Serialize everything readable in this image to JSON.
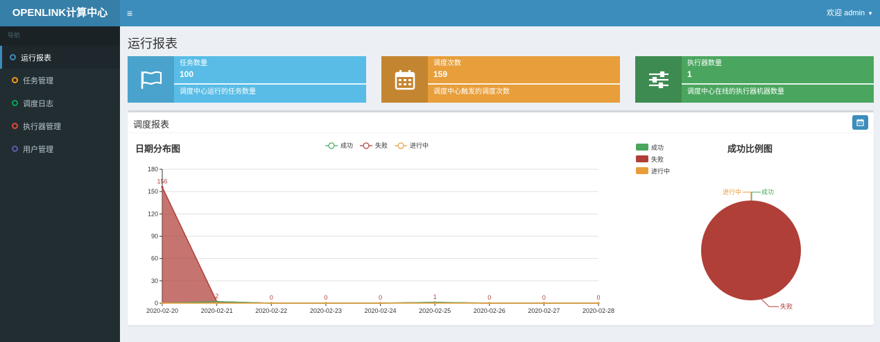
{
  "app": {
    "logo": "OPENLINK计算中心",
    "menu_toggle": "≡",
    "user_label": "欢迎 admin",
    "user_caret": "▼"
  },
  "sidebar": {
    "header": "导航",
    "items": [
      {
        "label": "运行报表",
        "color": "#3c8dbc"
      },
      {
        "label": "任务管理",
        "color": "#f39c12"
      },
      {
        "label": "调度日志",
        "color": "#00a65a"
      },
      {
        "label": "执行器管理",
        "color": "#dd4b39"
      },
      {
        "label": "用户管理",
        "color": "#605ca8"
      }
    ]
  },
  "page": {
    "title": "运行报表"
  },
  "info_boxes": [
    {
      "label": "任务数量",
      "value": "100",
      "desc": "调度中心运行的任务数量",
      "color": "#58bce6",
      "icon_bg": "#4aa3cc",
      "icon": "flag-icon"
    },
    {
      "label": "调度次数",
      "value": "159",
      "desc": "调度中心触发的调度次数",
      "color": "#e89e3a",
      "icon_bg": "#c48530",
      "icon": "calendar-icon"
    },
    {
      "label": "执行器数量",
      "value": "1",
      "desc": "调度中心在线的执行器机器数量",
      "color": "#4aa65f",
      "icon_bg": "#3d8b50",
      "icon": "sliders-icon"
    }
  ],
  "report": {
    "title": "调度报表",
    "date_button_icon": "calendar-icon"
  },
  "chart_data": [
    {
      "type": "area",
      "title": "日期分布图",
      "categories": [
        "2020-02-20",
        "2020-02-21",
        "2020-02-22",
        "2020-02-23",
        "2020-02-24",
        "2020-02-25",
        "2020-02-26",
        "2020-02-27",
        "2020-02-28"
      ],
      "ylim": [
        0,
        180
      ],
      "yticks": [
        0,
        30,
        60,
        90,
        120,
        150,
        180
      ],
      "grid": true,
      "legend_position": "top",
      "series": [
        {
          "name": "成功",
          "values": [
            0,
            2,
            0,
            0,
            0,
            1,
            0,
            0,
            0
          ],
          "color": "#4aa65f"
        },
        {
          "name": "失败",
          "values": [
            156,
            2,
            0,
            0,
            0,
            1,
            0,
            0,
            0
          ],
          "color": "#b03f38"
        },
        {
          "name": "进行中",
          "values": [
            0,
            0,
            0,
            0,
            0,
            0,
            0,
            0,
            0
          ],
          "color": "#e89e3a"
        }
      ],
      "data_labels": [
        "156",
        "2",
        "0",
        "0",
        "0",
        "1",
        "0",
        "0",
        "0"
      ]
    },
    {
      "type": "pie",
      "title": "成功比例图",
      "legend_position": "top-left",
      "slices": [
        {
          "name": "成功",
          "value": 0,
          "color": "#4aa65f"
        },
        {
          "name": "失败",
          "value": 159,
          "color": "#b03f38"
        },
        {
          "name": "进行中",
          "value": 0,
          "color": "#e89e3a"
        }
      ]
    }
  ]
}
